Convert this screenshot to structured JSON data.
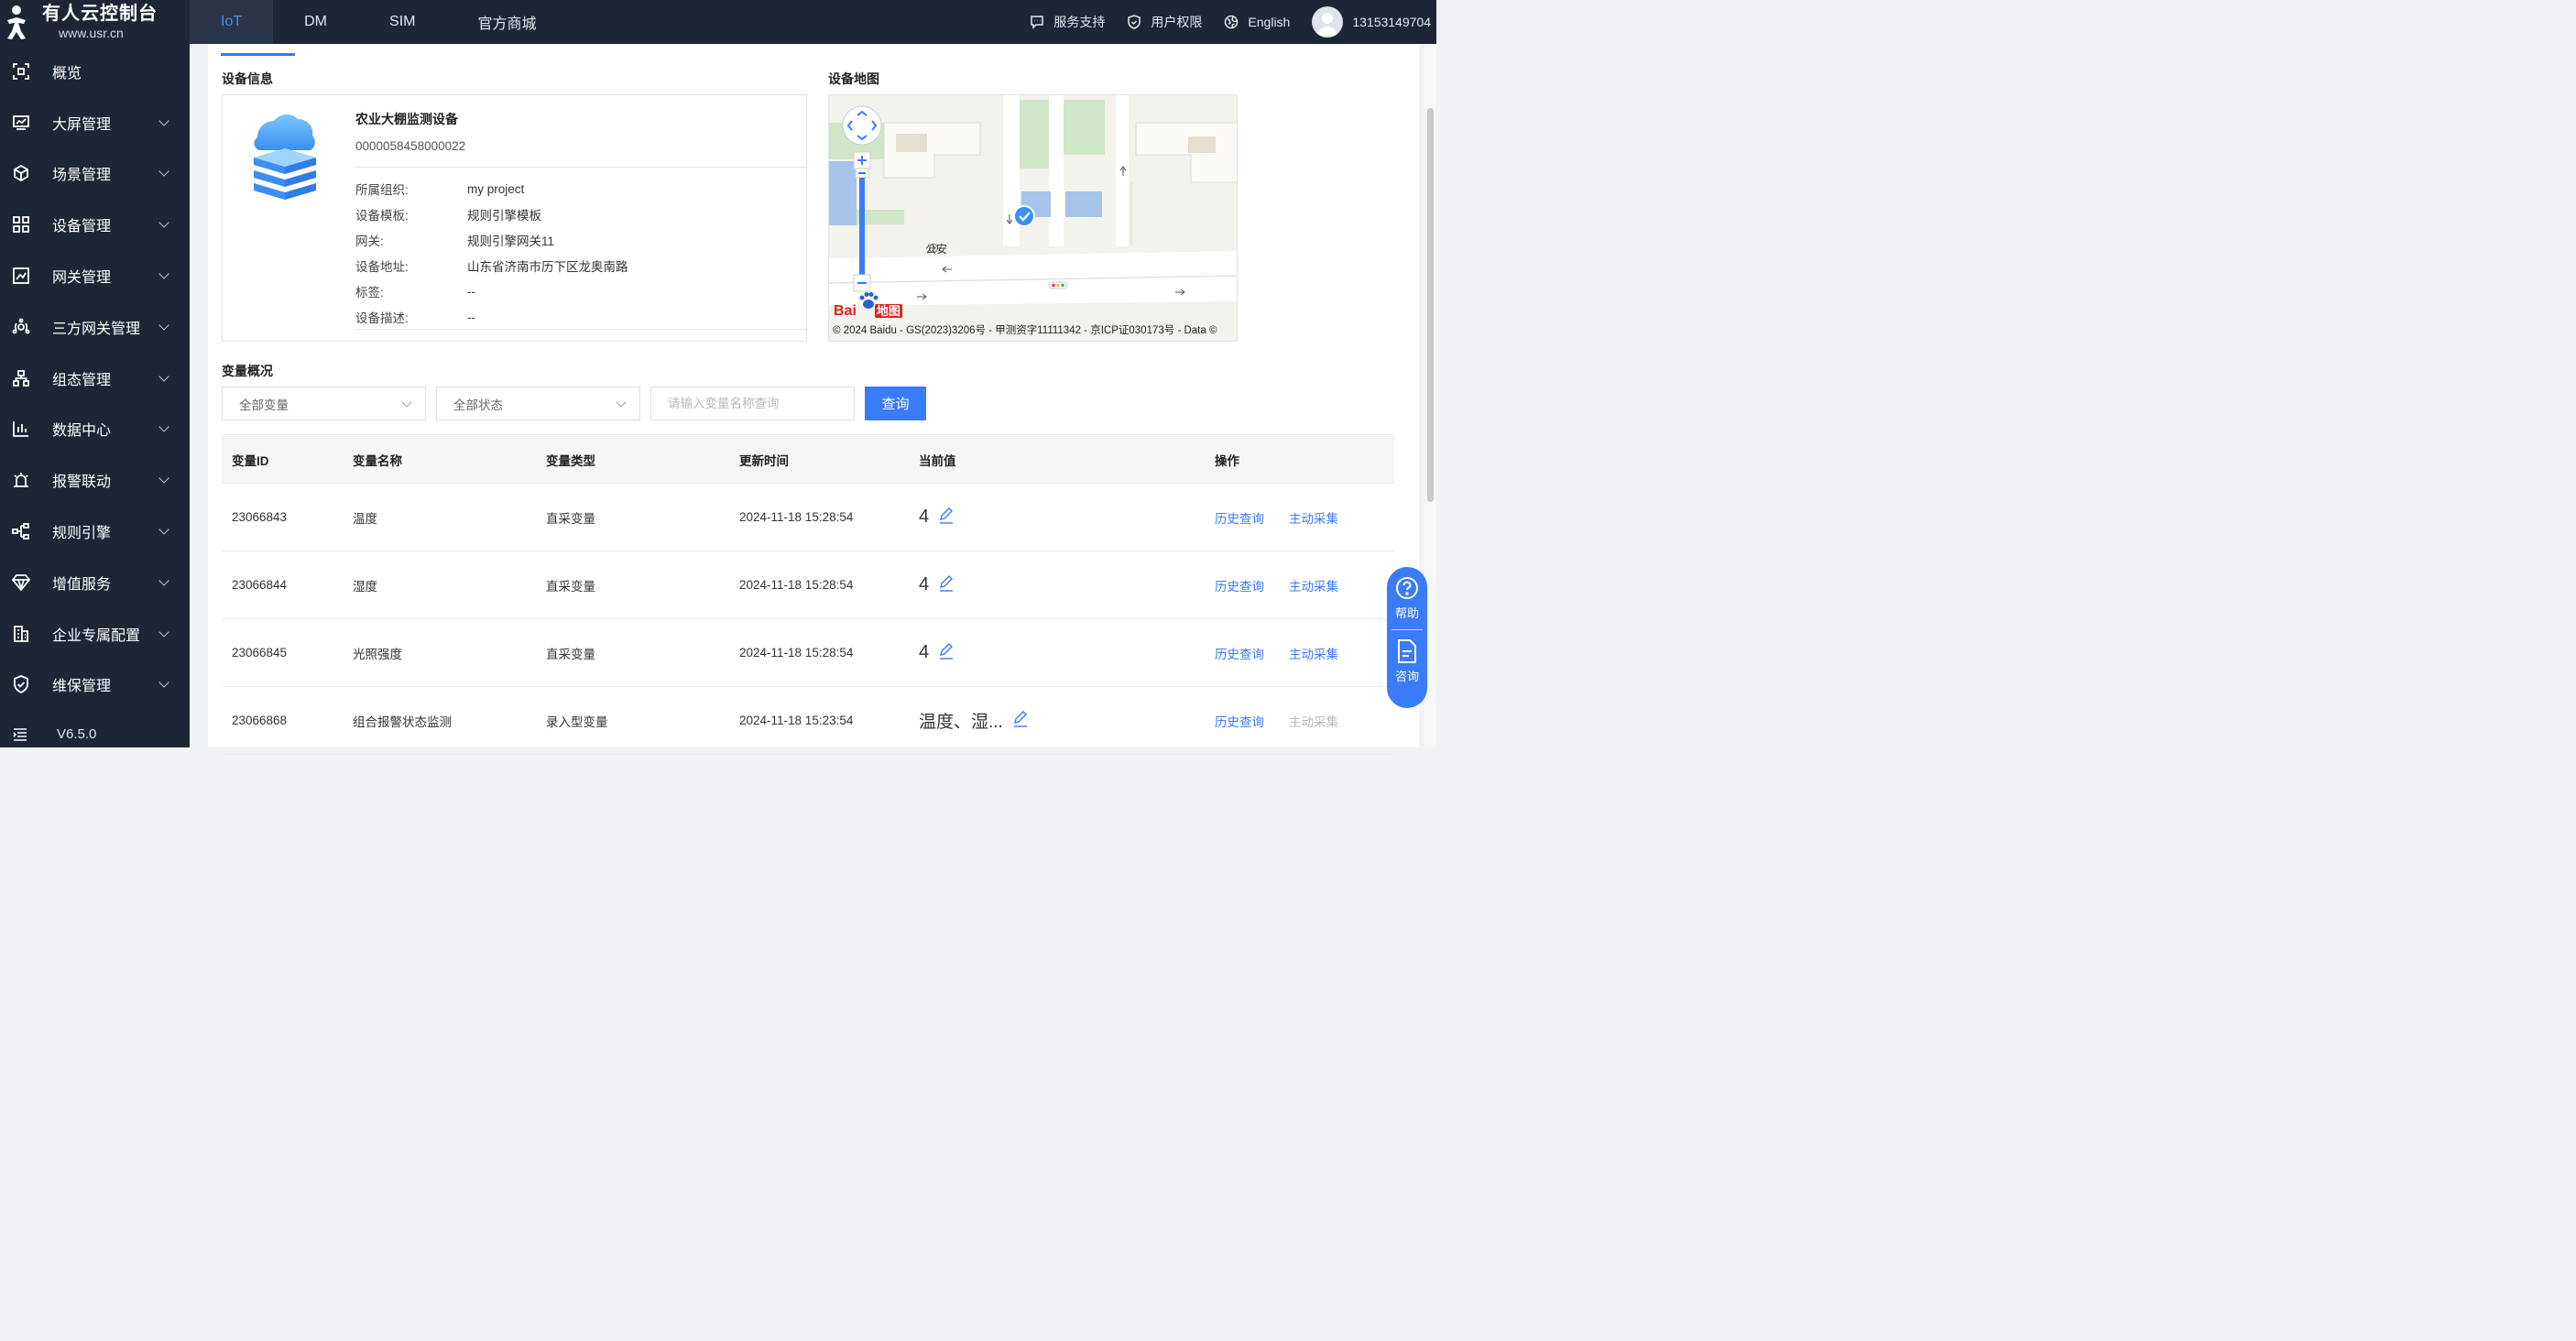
{
  "brand": {
    "title": "有人云控制台",
    "subtitle": "www.usr.cn"
  },
  "top_tabs": [
    {
      "label": "IoT",
      "active": true
    },
    {
      "label": "DM"
    },
    {
      "label": "SIM"
    },
    {
      "label": "官方商城"
    }
  ],
  "top_right": {
    "support": "服务支持",
    "permissions": "用户权限",
    "language": "English",
    "username": "13153149704"
  },
  "sidebar": {
    "items": [
      {
        "label": "概览",
        "icon": "overview-icon",
        "has_children": false
      },
      {
        "label": "大屏管理",
        "icon": "screen-icon",
        "has_children": true
      },
      {
        "label": "场景管理",
        "icon": "cube-icon",
        "has_children": true
      },
      {
        "label": "设备管理",
        "icon": "device-grid-icon",
        "has_children": true
      },
      {
        "label": "网关管理",
        "icon": "gateway-chart-icon",
        "has_children": true
      },
      {
        "label": "三方网关管理",
        "icon": "third-party-icon",
        "has_children": true
      },
      {
        "label": "组态管理",
        "icon": "topology-icon",
        "has_children": true
      },
      {
        "label": "数据中心",
        "icon": "bar-chart-icon",
        "has_children": true
      },
      {
        "label": "报警联动",
        "icon": "alarm-icon",
        "has_children": true
      },
      {
        "label": "规则引擎",
        "icon": "rule-flow-icon",
        "has_children": true
      },
      {
        "label": "增值服务",
        "icon": "diamond-icon",
        "has_children": true
      },
      {
        "label": "企业专属配置",
        "icon": "building-icon",
        "has_children": true
      },
      {
        "label": "维保管理",
        "icon": "shield-check-icon",
        "has_children": true
      }
    ],
    "version": "V6.5.0"
  },
  "device_info": {
    "section_title": "设备信息",
    "name": "农业大棚监测设备",
    "id": "0000058458000022",
    "fields": [
      {
        "key": "所属组织:",
        "value": "my project"
      },
      {
        "key": "设备模板:",
        "value": "规则引擎模板"
      },
      {
        "key": "网关:",
        "value": "规则引擎网关11"
      },
      {
        "key": "设备地址:",
        "value": "山东省济南市历下区龙奥南路"
      },
      {
        "key": "标签:",
        "value": "--"
      },
      {
        "key": "设备描述:",
        "value": "--"
      }
    ]
  },
  "device_map": {
    "section_title": "设备地图",
    "poi_label": "公安",
    "logo_text": "Bai",
    "logo_text2": "地图",
    "copyright": "© 2024 Baidu - GS(2023)3206号 - 甲测资字11111342 - 京ICP证030173号 - Data ©"
  },
  "variables": {
    "section_title": "变量概况",
    "filter_variable": "全部变量",
    "filter_status": "全部状态",
    "search_placeholder": "请输入变量名称查询",
    "query_button": "查询",
    "columns": [
      "变量ID",
      "变量名称",
      "变量类型",
      "更新时间",
      "当前值",
      "操作"
    ],
    "rows": [
      {
        "id": "23066843",
        "name": "温度",
        "type": "直采变量",
        "time": "2024-11-18 15:28:54",
        "value": "4",
        "ops": [
          "历史查询",
          "主动采集"
        ],
        "collect_disabled": false
      },
      {
        "id": "23066844",
        "name": "湿度",
        "type": "直采变量",
        "time": "2024-11-18 15:28:54",
        "value": "4",
        "ops": [
          "历史查询",
          "主动采集"
        ],
        "collect_disabled": false
      },
      {
        "id": "23066845",
        "name": "光照强度",
        "type": "直采变量",
        "time": "2024-11-18 15:28:54",
        "value": "4",
        "ops": [
          "历史查询",
          "主动采集"
        ],
        "collect_disabled": false
      },
      {
        "id": "23066868",
        "name": "组合报警状态监测",
        "type": "录入型变量",
        "time": "2024-11-18 15:23:54",
        "value": "温度、湿...",
        "ops": [
          "历史查询",
          "主动采集"
        ],
        "collect_disabled": true
      }
    ]
  },
  "help_widget": {
    "help": "帮助",
    "consult": "咨询"
  },
  "colors": {
    "sidebar_bg": "#1d2536",
    "accent": "#3a7bf7",
    "active_tab_text": "#4a8cff"
  }
}
